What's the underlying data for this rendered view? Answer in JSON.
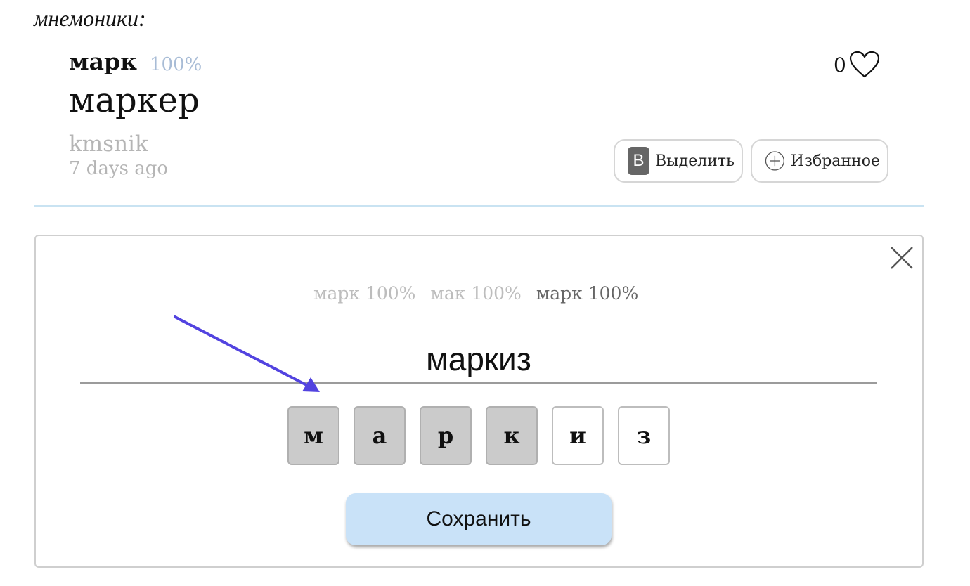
{
  "section": {
    "heading": "мнемоники:"
  },
  "card": {
    "word": "марк",
    "percent": "100%",
    "mnemonic": "маркер",
    "author": "kmsnik",
    "time": "7 days ago",
    "likes_count": "0",
    "highlight_badge": "В",
    "highlight_label": "Выделить",
    "favorite_label": "Избранное"
  },
  "editor": {
    "variants": [
      {
        "label": "марк 100%",
        "active": false
      },
      {
        "label": "мак 100%",
        "active": false
      },
      {
        "label": "марк 100%",
        "active": true
      }
    ],
    "input_value": "маркиз",
    "letters": [
      {
        "char": "м",
        "matched": true
      },
      {
        "char": "а",
        "matched": true
      },
      {
        "char": "р",
        "matched": true
      },
      {
        "char": "к",
        "matched": true
      },
      {
        "char": "и",
        "matched": false
      },
      {
        "char": "з",
        "matched": false
      }
    ],
    "save_label": "Сохранить"
  },
  "colors": {
    "accent_arrow": "#5243e0",
    "percent": "#a8bcd6",
    "save_button": "#c9e2f8",
    "divider": "#c9e3f2"
  }
}
